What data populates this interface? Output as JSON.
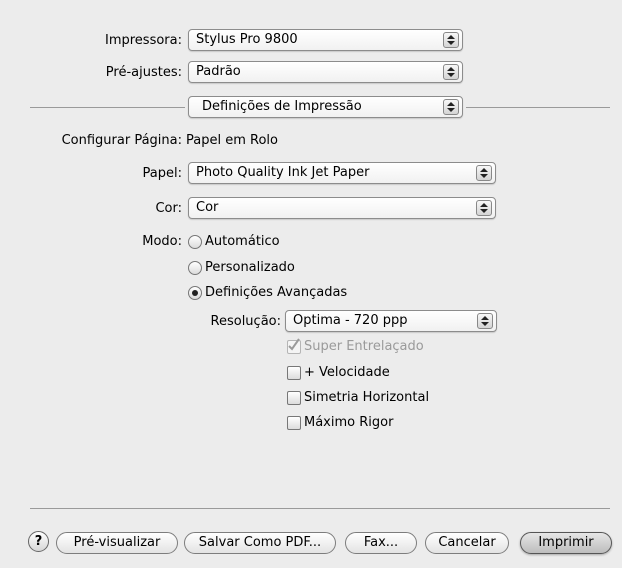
{
  "printer": {
    "label": "Impressora:",
    "value": "Stylus Pro 9800"
  },
  "presets": {
    "label": "Pré-ajustes:",
    "value": "Padrão"
  },
  "panel": {
    "value": "Definições de Impressão"
  },
  "page_setup": {
    "label": "Configurar Página:",
    "value": "Papel em Rolo"
  },
  "paper": {
    "label": "Papel:",
    "value": "Photo Quality Ink Jet Paper"
  },
  "color": {
    "label": "Cor:",
    "value": "Cor"
  },
  "mode": {
    "label": "Modo:",
    "options": [
      {
        "label": "Automático",
        "selected": false
      },
      {
        "label": "Personalizado",
        "selected": false
      },
      {
        "label": "Definições Avançadas",
        "selected": true
      }
    ]
  },
  "resolution": {
    "label": "Resolução:",
    "value": "Optima - 720 ppp"
  },
  "checkboxes": [
    {
      "label": "Super Entrelaçado",
      "checked": true,
      "enabled": false
    },
    {
      "label": "+ Velocidade",
      "checked": false,
      "enabled": true
    },
    {
      "label": "Simetria Horizontal",
      "checked": false,
      "enabled": true
    },
    {
      "label": "Máximo Rigor",
      "checked": false,
      "enabled": true
    }
  ],
  "footer": {
    "help": "?",
    "preview": "Pré-visualizar",
    "save_pdf": "Salvar Como PDF...",
    "fax": "Fax...",
    "cancel": "Cancelar",
    "print": "Imprimir"
  }
}
